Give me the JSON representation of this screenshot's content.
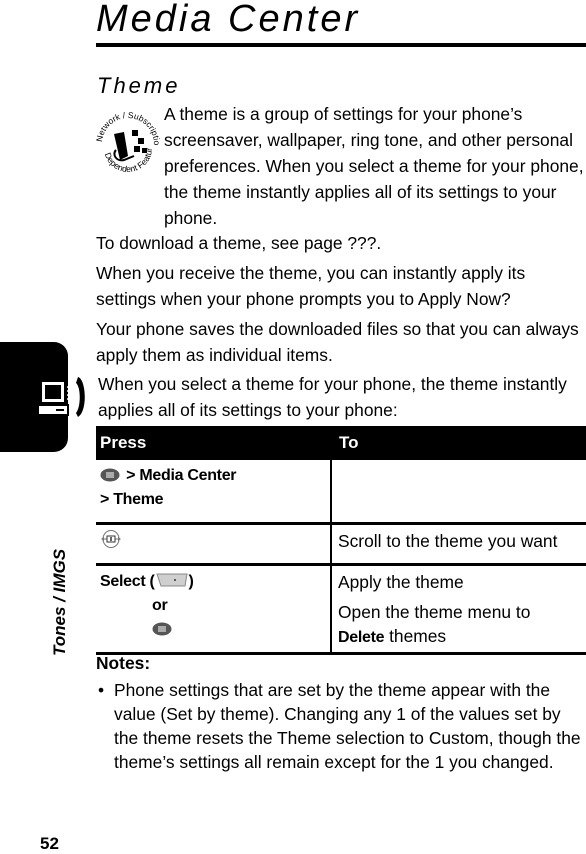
{
  "header": {
    "title": "Media Center"
  },
  "section": {
    "title": "Theme",
    "badge_icon": "network-subscription-dependent-feature-icon",
    "badge_text_top": "Network / Subscription",
    "badge_text_bottom": "Dependent Feature",
    "intro": "A theme is a group of settings for your phone’s screensaver, wallpaper, ring tone, and other personal preferences. When you select a theme for your phone, the theme instantly applies all of its settings to your phone.",
    "paragraphs": [
      "To download a theme, see page ???.",
      "When you receive the theme, you can instantly apply its settings when your phone prompts you to Apply Now?",
      "Your phone saves the downloaded files so that you can always apply them as individual items.",
      "When you select a theme for your phone, the theme instantly applies all of its settings to your phone:"
    ]
  },
  "side_tab": {
    "icon": "phone-computer-icon",
    "label": "Tones / IMGS"
  },
  "table": {
    "headers": [
      "Press",
      "To"
    ],
    "rows": [
      {
        "press_icon": "menu-key-icon",
        "press_text_1": "> Media Center",
        "press_text_2": "> Theme",
        "to": ""
      },
      {
        "press_icon": "navigation-key-icon",
        "to": "Scroll to the theme you want"
      },
      {
        "press_text_1": "Select (",
        "press_icon": "soft-key-icon",
        "press_text_close": ")",
        "press_or": "or",
        "press_icon_2": "menu-key-icon",
        "to_1": "Apply the theme",
        "to_2_prefix": "Open the theme menu to",
        "to_2_bold": "Delete",
        "to_2_suffix": " themes"
      }
    ]
  },
  "notes": {
    "title": "Notes:",
    "bullet": "•",
    "items": [
      "Phone settings that are set by the theme appear with the value (Set by theme). Changing any 1 of the values set by the theme resets the Theme selection to Custom, though the theme’s settings all remain except for the 1 you changed."
    ]
  },
  "footer": {
    "page_number": "52"
  }
}
